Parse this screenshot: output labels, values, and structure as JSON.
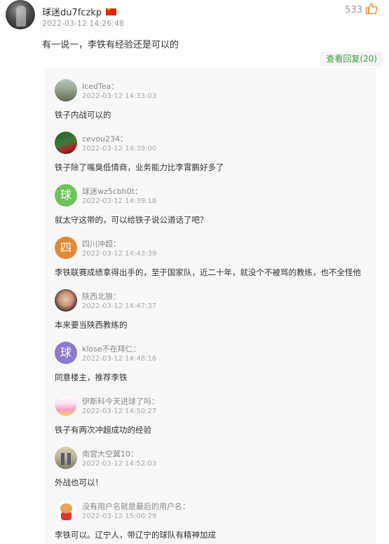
{
  "comment": {
    "username": "球迷du7fczkp",
    "time": "2022-03-12 14:26:48",
    "likes": "533",
    "content": "有一说一，李铁有经验还是可以的",
    "view_replies": "查看回复(20)"
  },
  "replies": [
    {
      "avatar_text": "",
      "username": "IcedTea：",
      "time": "2022-03-12 14:33:03",
      "content": "铁子内战可以的"
    },
    {
      "avatar_text": "",
      "username": "cevou234：",
      "time": "2022-03-12 14:39:00",
      "content": "铁子除了嘴臭低情商，业务能力比李霄鹏好多了"
    },
    {
      "avatar_text": "球",
      "username": "球迷wz5cbh0t：",
      "time": "2022-03-12 14:39:18",
      "content": "就太守这带的，可以给铁子说公道话了吧？"
    },
    {
      "avatar_text": "四",
      "username": "四川冲超：",
      "time": "2022-03-12 14:43:39",
      "content": "李铁联赛成绩拿得出手的，至于国家队，近二十年，就没个不被骂的教练，也不全怪他"
    },
    {
      "avatar_text": "",
      "username": "陕西北狼：",
      "time": "2022-03-12 14:47:37",
      "content": "本来要当陕西教练的"
    },
    {
      "avatar_text": "球",
      "username": "klose不在拜仁：",
      "time": "2022-03-12 14:48:16",
      "content": "同意楼主，推荐李铁"
    },
    {
      "avatar_text": "",
      "username": "伊斯科今天进球了吗：",
      "time": "2022-03-12 14:50:27",
      "content": "铁子有两次冲超成功的经验"
    },
    {
      "avatar_text": "",
      "username": "南宫大空翼10：",
      "time": "2022-03-12 14:52:03",
      "content": "外战也可以！"
    },
    {
      "avatar_text": "",
      "username": "没有用户名就是最后的用户名：",
      "time": "2022-03-12 15:00:29",
      "content": "李铁可以。辽宁人，带辽宁的球队有精神加成"
    }
  ],
  "colors": {
    "link_green": "#3d9c47",
    "reply_bg": "#f7f7f7",
    "avatar_green": "#6dc25b",
    "avatar_orange": "#e08a38",
    "avatar_purple": "#8d7acb"
  },
  "icons": {
    "like": "thumbs-up-icon",
    "flag": "china-flag-icon"
  }
}
